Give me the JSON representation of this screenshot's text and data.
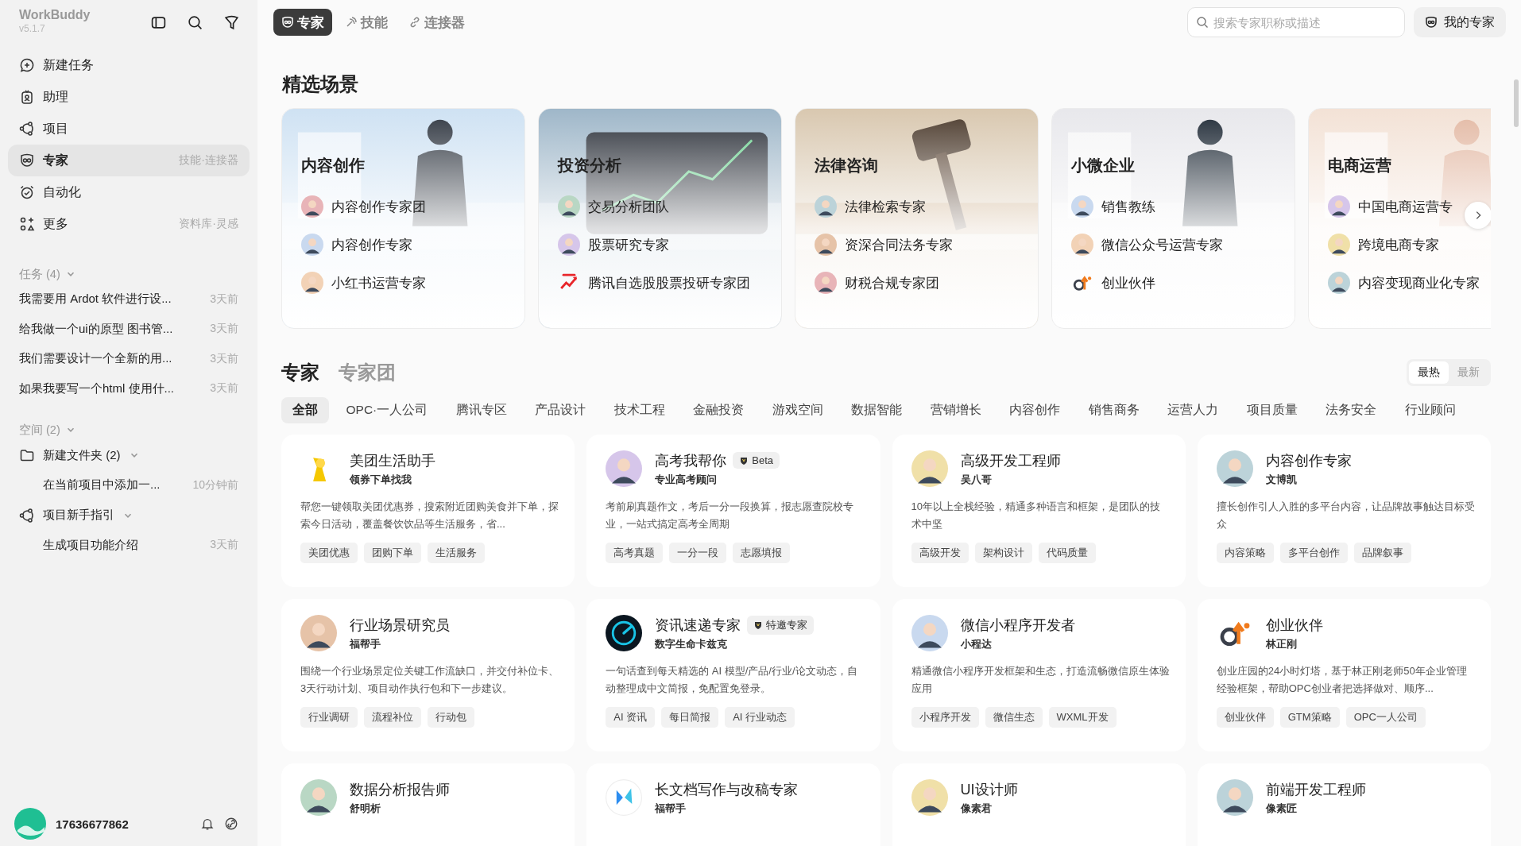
{
  "app": {
    "name": "WorkBuddy",
    "version": "v5.1.7"
  },
  "sidebar": {
    "nav": [
      {
        "label": "新建任务",
        "selected": false
      },
      {
        "label": "助理",
        "selected": false
      },
      {
        "label": "项目",
        "selected": false
      },
      {
        "label": "专家",
        "selected": true,
        "hint": "技能·连接器"
      },
      {
        "label": "自动化",
        "selected": false
      },
      {
        "label": "更多",
        "selected": false,
        "hint": "资料库·灵感"
      }
    ],
    "tasks": {
      "title": "任务 (4)",
      "expanded": true,
      "items": [
        {
          "title": "我需要用 Ardot 软件进行设...",
          "time": "3天前"
        },
        {
          "title": "给我做一个ui的原型 图书管...",
          "time": "3天前"
        },
        {
          "title": "我们需要设计一个全新的用...",
          "time": "3天前"
        },
        {
          "title": "如果我要写一个html 使用什...",
          "time": "3天前"
        }
      ]
    },
    "spaces": {
      "title": "空间 (2)",
      "expanded": true,
      "folders": [
        {
          "name": "新建文件夹 (2)",
          "kind": "folder",
          "expanded": true,
          "children": [
            {
              "title": "在当前项目中添加一...",
              "time": "10分钟前"
            }
          ]
        },
        {
          "name": "项目新手指引",
          "kind": "project",
          "expanded": true,
          "children": [
            {
              "title": "生成项目功能介绍",
              "time": "3天前"
            }
          ]
        }
      ]
    },
    "user": {
      "name": "17636677862"
    }
  },
  "topbar": {
    "tabs": [
      {
        "label": "专家",
        "selected": true
      },
      {
        "label": "技能",
        "selected": false
      },
      {
        "label": "连接器",
        "selected": false
      }
    ],
    "search": {
      "placeholder": "搜索专家职称或描述"
    },
    "my_button": "我的专家"
  },
  "featured": {
    "title": "精选场景",
    "scenes": [
      {
        "title": "内容创作",
        "items": [
          {
            "name": "内容创作专家团",
            "kind": "person"
          },
          {
            "name": "内容创作专家",
            "kind": "person"
          },
          {
            "name": "小红书运营专家",
            "kind": "person"
          }
        ]
      },
      {
        "title": "投资分析",
        "items": [
          {
            "name": "交易分析团队",
            "kind": "person"
          },
          {
            "name": "股票研究专家",
            "kind": "person"
          },
          {
            "name": "腾讯自选股股票投研专家团",
            "kind": "stock"
          }
        ]
      },
      {
        "title": "法律咨询",
        "items": [
          {
            "name": "法律检索专家",
            "kind": "person"
          },
          {
            "name": "资深合同法务专家",
            "kind": "person"
          },
          {
            "name": "财税合规专家团",
            "kind": "person"
          }
        ]
      },
      {
        "title": "小微企业",
        "items": [
          {
            "name": "销售教练",
            "kind": "person"
          },
          {
            "name": "微信公众号运营专家",
            "kind": "person"
          },
          {
            "name": "创业伙伴",
            "kind": "startup"
          }
        ]
      },
      {
        "title": "电商运营",
        "items": [
          {
            "name": "中国电商运营专",
            "kind": "person"
          },
          {
            "name": "跨境电商专家",
            "kind": "person"
          },
          {
            "name": "内容变现商业化专家",
            "kind": "person"
          }
        ]
      }
    ]
  },
  "experts": {
    "tabs": [
      {
        "label": "专家",
        "selected": true
      },
      {
        "label": "专家团",
        "selected": false
      }
    ],
    "sort": [
      {
        "label": "最热",
        "selected": true
      },
      {
        "label": "最新",
        "selected": false
      }
    ],
    "categories": [
      {
        "label": "全部",
        "selected": true
      },
      {
        "label": "OPC·一人公司",
        "selected": false
      },
      {
        "label": "腾讯专区",
        "selected": false
      },
      {
        "label": "产品设计",
        "selected": false
      },
      {
        "label": "技术工程",
        "selected": false
      },
      {
        "label": "金融投资",
        "selected": false
      },
      {
        "label": "游戏空间",
        "selected": false
      },
      {
        "label": "数据智能",
        "selected": false
      },
      {
        "label": "营销增长",
        "selected": false
      },
      {
        "label": "内容创作",
        "selected": false
      },
      {
        "label": "销售商务",
        "selected": false
      },
      {
        "label": "运营人力",
        "selected": false
      },
      {
        "label": "项目质量",
        "selected": false
      },
      {
        "label": "法务安全",
        "selected": false
      },
      {
        "label": "行业顾问",
        "selected": false
      }
    ],
    "cards": [
      {
        "name": "美团生活助手",
        "subtitle": "领券下单找我",
        "kind": "kangaroo",
        "description": "帮您一键领取美团优惠券，搜索附近团购美食并下单，探索今日活动，覆盖餐饮饮品等生活服务，省...",
        "tags": [
          "美团优惠",
          "团购下单",
          "生活服务"
        ]
      },
      {
        "name": "高考我帮你",
        "subtitle": "专业高考顾问",
        "kind": "person",
        "badge": "Beta",
        "description": "考前刷真题作文，考后一分一段换算，报志愿查院校专业，一站式搞定高考全周期",
        "tags": [
          "高考真题",
          "一分一段",
          "志愿填报"
        ]
      },
      {
        "name": "高级开发工程师",
        "subtitle": "吴八哥",
        "kind": "person",
        "description": "10年以上全栈经验，精通多种语言和框架，是团队的技术中坚",
        "tags": [
          "高级开发",
          "架构设计",
          "代码质量"
        ]
      },
      {
        "name": "内容创作专家",
        "subtitle": "文博凯",
        "kind": "person",
        "description": "擅长创作引人入胜的多平台内容，让品牌故事触达目标受众",
        "tags": [
          "内容策略",
          "多平台创作",
          "品牌叙事"
        ]
      },
      {
        "name": "行业场景研究员",
        "subtitle": "福帮手",
        "kind": "person",
        "description": "围绕一个行业场景定位关键工作流缺口，并交付补位卡、3天行动计划、项目动作执行包和下一步建议。",
        "tags": [
          "行业调研",
          "流程补位",
          "行动包"
        ]
      },
      {
        "name": "资讯速递专家",
        "subtitle": "数字生命卡兹克",
        "kind": "gauge",
        "badge": "特邀专家",
        "description": "一句话查到每天精选的 AI 模型/产品/行业/论文动态，自动整理成中文简报，免配置免登录。",
        "tags": [
          "AI 资讯",
          "每日简报",
          "AI 行业动态"
        ]
      },
      {
        "name": "微信小程序开发者",
        "subtitle": "小程达",
        "kind": "person",
        "description": "精通微信小程序开发框架和生态，打造流畅微信原生体验应用",
        "tags": [
          "小程序开发",
          "微信生态",
          "WXML开发"
        ]
      },
      {
        "name": "创业伙伴",
        "subtitle": "林正刚",
        "kind": "startup",
        "description": "创业庄园的24小时灯塔，基于林正刚老师50年企业管理经验框架，帮助OPC创业者把选择做对、顺序...",
        "tags": [
          "创业伙伴",
          "GTM策略",
          "OPC一人公司"
        ]
      },
      {
        "name": "数据分析报告师",
        "subtitle": "舒明析",
        "kind": "person"
      },
      {
        "name": "长文档写作与改稿专家",
        "subtitle": "福帮手",
        "kind": "butterfly"
      },
      {
        "name": "UI设计师",
        "subtitle": "像素君",
        "kind": "person"
      },
      {
        "name": "前端开发工程师",
        "subtitle": "像素匠",
        "kind": "person"
      }
    ]
  }
}
